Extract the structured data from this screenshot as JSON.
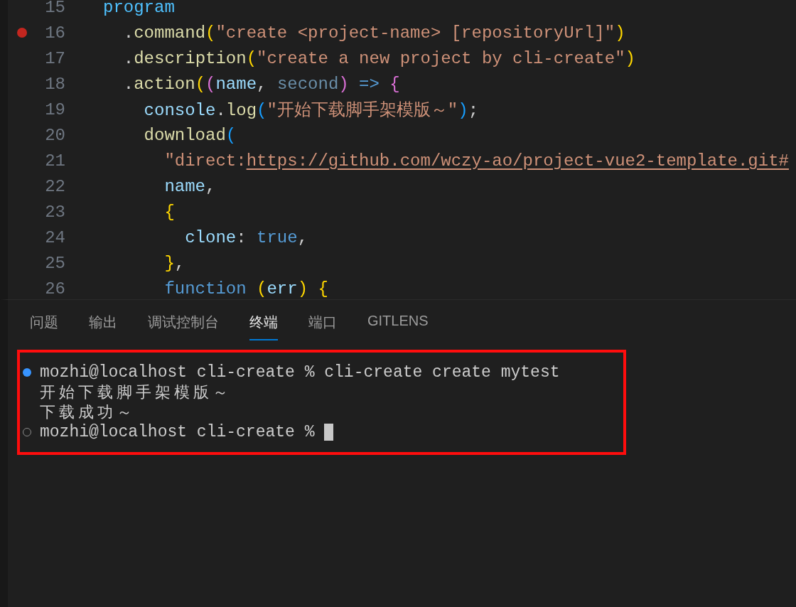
{
  "editor": {
    "lines": [
      {
        "number": "15",
        "breakpoint": false,
        "tokens": [
          {
            "text": "program",
            "kind": "var"
          }
        ]
      },
      {
        "number": "16",
        "breakpoint": true,
        "tokens": [
          {
            "text": "  .",
            "kind": "punct"
          },
          {
            "text": "command",
            "kind": "method"
          },
          {
            "text": "(",
            "kind": "bracket1"
          },
          {
            "text": "\"create <project-name> [repositoryUrl]\"",
            "kind": "string"
          },
          {
            "text": ")",
            "kind": "bracket1"
          }
        ]
      },
      {
        "number": "17",
        "breakpoint": false,
        "tokens": [
          {
            "text": "  .",
            "kind": "punct"
          },
          {
            "text": "description",
            "kind": "method"
          },
          {
            "text": "(",
            "kind": "bracket1"
          },
          {
            "text": "\"create a new project by cli-create\"",
            "kind": "string"
          },
          {
            "text": ")",
            "kind": "bracket1"
          }
        ]
      },
      {
        "number": "18",
        "breakpoint": false,
        "tokens": [
          {
            "text": "  .",
            "kind": "punct"
          },
          {
            "text": "action",
            "kind": "method"
          },
          {
            "text": "(",
            "kind": "bracket1"
          },
          {
            "text": "(",
            "kind": "bracket2"
          },
          {
            "text": "name",
            "kind": "param"
          },
          {
            "text": ", ",
            "kind": "punct"
          },
          {
            "text": "second",
            "kind": "unused"
          },
          {
            "text": ")",
            "kind": "bracket2"
          },
          {
            "text": " => ",
            "kind": "keyword"
          },
          {
            "text": "{",
            "kind": "bracket2"
          }
        ]
      },
      {
        "number": "19",
        "breakpoint": false,
        "tokens": [
          {
            "text": "    console",
            "kind": "param"
          },
          {
            "text": ".",
            "kind": "punct"
          },
          {
            "text": "log",
            "kind": "method"
          },
          {
            "text": "(",
            "kind": "bracket3"
          },
          {
            "text": "\"开始下载脚手架模版～\"",
            "kind": "string"
          },
          {
            "text": ")",
            "kind": "bracket3"
          },
          {
            "text": ";",
            "kind": "punct"
          }
        ]
      },
      {
        "number": "20",
        "breakpoint": false,
        "tokens": [
          {
            "text": "    download",
            "kind": "method"
          },
          {
            "text": "(",
            "kind": "bracket3"
          }
        ]
      },
      {
        "number": "21",
        "breakpoint": false,
        "tokens": [
          {
            "text": "      \"direct:",
            "kind": "string"
          },
          {
            "text": "https://github.com/wczy-ao/project-vue2-template.git#",
            "kind": "link"
          }
        ]
      },
      {
        "number": "22",
        "breakpoint": false,
        "tokens": [
          {
            "text": "      name",
            "kind": "param"
          },
          {
            "text": ",",
            "kind": "punct"
          }
        ]
      },
      {
        "number": "23",
        "breakpoint": false,
        "tokens": [
          {
            "text": "      {",
            "kind": "bracket1"
          }
        ]
      },
      {
        "number": "24",
        "breakpoint": false,
        "tokens": [
          {
            "text": "        clone",
            "kind": "param"
          },
          {
            "text": ": ",
            "kind": "punct"
          },
          {
            "text": "true",
            "kind": "keyword"
          },
          {
            "text": ",",
            "kind": "punct"
          }
        ]
      },
      {
        "number": "25",
        "breakpoint": false,
        "tokens": [
          {
            "text": "      }",
            "kind": "bracket1"
          },
          {
            "text": ",",
            "kind": "punct"
          }
        ]
      },
      {
        "number": "26",
        "breakpoint": false,
        "tokens": [
          {
            "text": "      function",
            "kind": "keyword"
          },
          {
            "text": " (",
            "kind": "bracket1"
          },
          {
            "text": "err",
            "kind": "param"
          },
          {
            "text": ") {",
            "kind": "bracket1"
          }
        ]
      }
    ]
  },
  "panel": {
    "tabs": [
      {
        "label": "问题",
        "selected": false
      },
      {
        "label": "输出",
        "selected": false
      },
      {
        "label": "调试控制台",
        "selected": false
      },
      {
        "label": "终端",
        "selected": true
      },
      {
        "label": "端口",
        "selected": false
      },
      {
        "label": "GITLENS",
        "selected": false
      }
    ],
    "terminal": {
      "lines": [
        {
          "kind": "prompt",
          "completed": true,
          "text": "mozhi@localhost cli-create % cli-create create mytest",
          "cursor": false
        },
        {
          "kind": "output",
          "text": "开始下载脚手架模版～"
        },
        {
          "kind": "output",
          "text": "下载成功～"
        },
        {
          "kind": "prompt",
          "completed": false,
          "text": "mozhi@localhost cli-create %",
          "cursor": true
        }
      ]
    }
  }
}
